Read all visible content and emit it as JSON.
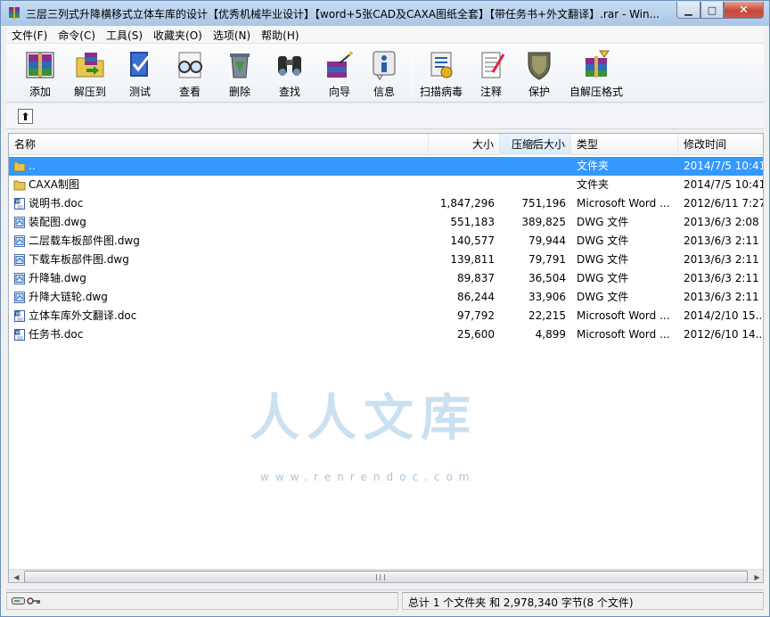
{
  "window": {
    "title": "三层三列式升降横移式立体车库的设计【优秀机械毕业设计】【word+5张CAD及CAXA图纸全套】【带任务书+外文翻译】.rar - Win...",
    "minimize_glyph": "▁",
    "maximize_glyph": "□",
    "close_glyph": "✕"
  },
  "menu": [
    {
      "label": "文件(F)"
    },
    {
      "label": "命令(C)"
    },
    {
      "label": "工具(S)"
    },
    {
      "label": "收藏夹(O)"
    },
    {
      "label": "选项(N)"
    },
    {
      "label": "帮助(H)"
    }
  ],
  "toolbar": {
    "items": [
      {
        "label": "添加",
        "icon": "books-add-icon"
      },
      {
        "label": "解压到",
        "icon": "folder-extract-icon"
      },
      {
        "label": "测试",
        "icon": "checklist-test-icon"
      },
      {
        "label": "查看",
        "icon": "glasses-view-icon"
      },
      {
        "label": "删除",
        "icon": "recycle-delete-icon"
      },
      {
        "label": "查找",
        "icon": "binoculars-find-icon"
      },
      {
        "label": "向导",
        "icon": "wizard-icon"
      },
      {
        "label": "信息",
        "icon": "info-icon"
      },
      {
        "label": "扫描病毒",
        "icon": "virus-scan-icon"
      },
      {
        "label": "注释",
        "icon": "comment-note-icon"
      },
      {
        "label": "保护",
        "icon": "shield-protect-icon"
      },
      {
        "label": "自解压格式",
        "icon": "sfx-archive-icon"
      }
    ]
  },
  "address": {
    "up_glyph": "⬆"
  },
  "columns": {
    "name": "名称",
    "size": "大小",
    "packed": "压缩后大小",
    "type": "类型",
    "modified": "修改时间",
    "sort_glyph": "▲"
  },
  "files": [
    {
      "name": "..",
      "size": "",
      "packed": "",
      "type": "文件夹",
      "modified": "2014/7/5 10:41",
      "kind": "folder",
      "selected": true
    },
    {
      "name": "CAXA制图",
      "size": "",
      "packed": "",
      "type": "文件夹",
      "modified": "2014/7/5 10:41",
      "kind": "folder",
      "selected": false
    },
    {
      "name": "说明书.doc",
      "size": "1,847,296",
      "packed": "751,196",
      "type": "Microsoft Word ...",
      "modified": "2012/6/11 7:27",
      "kind": "doc",
      "selected": false
    },
    {
      "name": "装配图.dwg",
      "size": "551,183",
      "packed": "389,825",
      "type": "DWG 文件",
      "modified": "2013/6/3 2:08",
      "kind": "dwg",
      "selected": false
    },
    {
      "name": "二层载车板部件图.dwg",
      "size": "140,577",
      "packed": "79,944",
      "type": "DWG 文件",
      "modified": "2013/6/3 2:11",
      "kind": "dwg",
      "selected": false
    },
    {
      "name": "下载车板部件图.dwg",
      "size": "139,811",
      "packed": "79,791",
      "type": "DWG 文件",
      "modified": "2013/6/3 2:11",
      "kind": "dwg",
      "selected": false
    },
    {
      "name": "升降轴.dwg",
      "size": "89,837",
      "packed": "36,504",
      "type": "DWG 文件",
      "modified": "2013/6/3 2:11",
      "kind": "dwg",
      "selected": false
    },
    {
      "name": "升降大链轮.dwg",
      "size": "86,244",
      "packed": "33,906",
      "type": "DWG 文件",
      "modified": "2013/6/3 2:11",
      "kind": "dwg",
      "selected": false
    },
    {
      "name": "立体车库外文翻译.doc",
      "size": "97,792",
      "packed": "22,215",
      "type": "Microsoft Word ...",
      "modified": "2014/2/10 15...",
      "kind": "doc",
      "selected": false
    },
    {
      "name": "任务书.doc",
      "size": "25,600",
      "packed": "4,899",
      "type": "Microsoft Word ...",
      "modified": "2012/6/10 14...",
      "kind": "doc",
      "selected": false
    }
  ],
  "scroll": {
    "left_glyph": "◀",
    "right_glyph": "▶"
  },
  "status": {
    "summary": "总计 1 个文件夹 和 2,978,340 字节(8 个文件)"
  },
  "watermark": {
    "text": "人人文库",
    "url": "www.renrendoc.com"
  },
  "colors": {
    "selection": "#3399ff",
    "titlebar": "#a9c6e6",
    "close": "#c7463a"
  }
}
